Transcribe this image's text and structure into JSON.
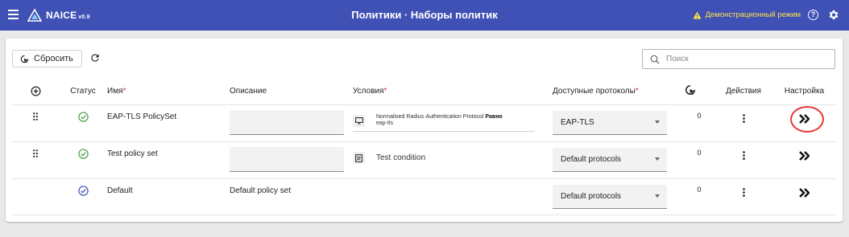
{
  "header": {
    "brand": "NAICE",
    "version": "v0.9",
    "title": "Политики · Наборы политик",
    "demo_mode": "Демонстрационный режим",
    "help_glyph": "?"
  },
  "toolbar": {
    "reset_label": "Сбросить",
    "search_placeholder": "Поиск"
  },
  "table": {
    "columns": {
      "status": "Статус",
      "name": "Имя",
      "description": "Описание",
      "conditions": "Условия",
      "protocols": "Доступные протоколы",
      "actions": "Действия",
      "settings": "Настройка"
    },
    "rows": [
      {
        "name": "EAP-TLS PolicySet",
        "description": "",
        "condition_attr": "Normalised Radius·Authentication Protocol",
        "condition_op": "Равно",
        "condition_value": "eap-tls",
        "protocol": "EAP-TLS",
        "hits": "0",
        "status": "green"
      },
      {
        "name": "Test policy set",
        "description": "",
        "condition_text": "Test condition",
        "protocol": "Default protocols",
        "hits": "0",
        "status": "green"
      },
      {
        "name": "Default",
        "description": "Default policy set",
        "protocol": "Default protocols",
        "hits": "0",
        "status": "blue"
      }
    ]
  },
  "colors": {
    "header_bg": "#3f51b5",
    "demo_text": "#ffe14a",
    "status_green": "#43a047",
    "status_blue": "#3f51b5",
    "required": "#d32f2f",
    "highlight": "#e53935"
  }
}
